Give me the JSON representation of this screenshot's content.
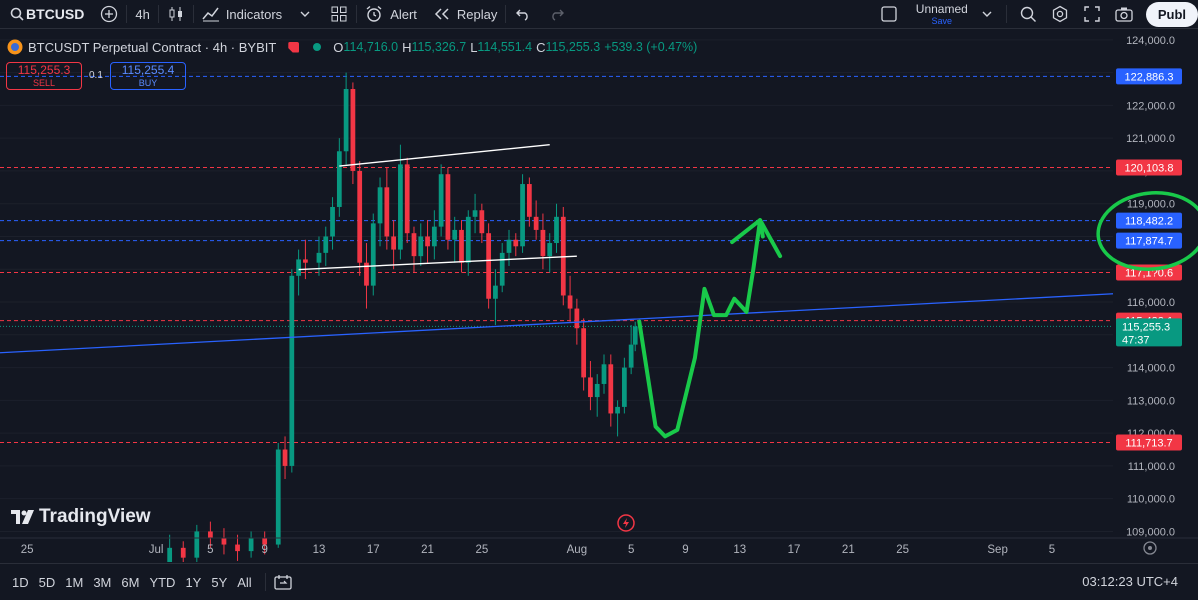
{
  "toolbar": {
    "symbol": "BTCUSD",
    "interval": "4h",
    "indicators": "Indicators",
    "alert": "Alert",
    "replay": "Replay",
    "layout_name": "Unnamed",
    "layout_status": "Save",
    "publish": "Publ"
  },
  "legend": {
    "title": "BTCUSDT Perpetual Contract · 4h · BYBIT",
    "o_label": "O",
    "o": "114,716.0",
    "h_label": "H",
    "h": "115,326.7",
    "l_label": "L",
    "l": "114,551.4",
    "c_label": "C",
    "c": "115,255.3",
    "change": "+539.3 (+0.47%)"
  },
  "trade": {
    "sell_price": "115,255.3",
    "sell_label": "SELL",
    "buy_price": "115,255.4",
    "buy_label": "BUY",
    "quantity": "0.1"
  },
  "price_axis": [
    "124,000.0",
    "123,000.0",
    "122,000.0",
    "121,000.0",
    "120,000.0",
    "119,000.0",
    "118,000.0",
    "117,000.0",
    "116,000.0",
    "115,000.0",
    "114,000.0",
    "113,000.0",
    "112,000.0",
    "111,000.0",
    "110,000.0",
    "109,000.0"
  ],
  "time_axis": [
    {
      "label": "25",
      "v": -9.5
    },
    {
      "label": "Jul",
      "v": 0
    },
    {
      "label": "5",
      "v": 4
    },
    {
      "label": "9",
      "v": 8
    },
    {
      "label": "13",
      "v": 12
    },
    {
      "label": "17",
      "v": 16
    },
    {
      "label": "21",
      "v": 20
    },
    {
      "label": "25",
      "v": 24
    },
    {
      "label": "Aug",
      "v": 31
    },
    {
      "label": "5",
      "v": 35
    },
    {
      "label": "9",
      "v": 39
    },
    {
      "label": "13",
      "v": 43
    },
    {
      "label": "17",
      "v": 47
    },
    {
      "label": "21",
      "v": 51
    },
    {
      "label": "25",
      "v": 55
    },
    {
      "label": "Sep",
      "v": 62
    },
    {
      "label": "5",
      "v": 66
    }
  ],
  "levels": [
    {
      "price": "122,886.3",
      "value": 122886.3,
      "color": "#2962ff"
    },
    {
      "price": "120,103.8",
      "value": 120103.8,
      "color": "#f23645"
    },
    {
      "price": "118,482.2",
      "value": 118482.2,
      "color": "#2962ff"
    },
    {
      "price": "117,874.7",
      "value": 117874.7,
      "color": "#2962ff"
    },
    {
      "price": "117,1?0.6",
      "value": 116900.0,
      "color": "#f23645"
    },
    {
      "price": "115,432.1",
      "value": 115432.1,
      "color": "#f23645"
    },
    {
      "price": "111,713.7",
      "value": 111713.7,
      "color": "#f23645"
    }
  ],
  "current": {
    "price": "115,255.3",
    "countdown": "47:37",
    "value": 115255.3,
    "color": "#089981"
  },
  "chart_data": {
    "type": "candlestick",
    "x_unit": "days from Jul 1",
    "series": [
      {
        "name": "BTCUSDT",
        "ohlc": [
          [
            1,
            107300,
            108900,
            107000,
            108500
          ],
          [
            2,
            108500,
            108700,
            107800,
            108200
          ],
          [
            3,
            108200,
            109200,
            107900,
            109000
          ],
          [
            4,
            109000,
            109300,
            108500,
            108800
          ],
          [
            5,
            108800,
            109100,
            108300,
            108600
          ],
          [
            6,
            108600,
            108900,
            108100,
            108400
          ],
          [
            7,
            108400,
            109000,
            108200,
            108800
          ],
          [
            8,
            108800,
            109000,
            108300,
            108600
          ],
          [
            9,
            108600,
            111700,
            108500,
            111500
          ],
          [
            9.5,
            111500,
            111900,
            110600,
            111000
          ],
          [
            10,
            111000,
            117000,
            110800,
            116800
          ],
          [
            10.5,
            116800,
            117600,
            116200,
            117300
          ],
          [
            11,
            117300,
            117900,
            116700,
            117200
          ],
          [
            12,
            117200,
            118000,
            116800,
            117500
          ],
          [
            12.5,
            117500,
            118300,
            117100,
            118000
          ],
          [
            13,
            118000,
            119200,
            117600,
            118900
          ],
          [
            13.5,
            118900,
            121000,
            118600,
            120600
          ],
          [
            14,
            120600,
            123000,
            120200,
            122500
          ],
          [
            14.5,
            122500,
            122700,
            119600,
            120000
          ],
          [
            15,
            120000,
            120300,
            116800,
            117200
          ],
          [
            15.5,
            117200,
            117800,
            115800,
            116500
          ],
          [
            16,
            116500,
            118700,
            116200,
            118400
          ],
          [
            16.5,
            118400,
            119800,
            117700,
            119500
          ],
          [
            17,
            119500,
            120100,
            117600,
            118000
          ],
          [
            17.5,
            118000,
            118500,
            117000,
            117600
          ],
          [
            18,
            117600,
            120800,
            117300,
            120200
          ],
          [
            18.5,
            120200,
            120400,
            117800,
            118100
          ],
          [
            19,
            118100,
            118300,
            116900,
            117400
          ],
          [
            19.5,
            117400,
            118400,
            117100,
            118000
          ],
          [
            20,
            118000,
            118500,
            117200,
            117700
          ],
          [
            20.5,
            117700,
            118800,
            117300,
            118300
          ],
          [
            21,
            118300,
            120200,
            118000,
            119900
          ],
          [
            21.5,
            119900,
            120100,
            117600,
            117900
          ],
          [
            22,
            117900,
            118600,
            117200,
            118200
          ],
          [
            22.5,
            118200,
            118500,
            116900,
            117200
          ],
          [
            23,
            117200,
            118800,
            116800,
            118600
          ],
          [
            23.5,
            118600,
            119300,
            118100,
            118800
          ],
          [
            24,
            118800,
            119000,
            117800,
            118100
          ],
          [
            24.5,
            118100,
            118400,
            115800,
            116100
          ],
          [
            25,
            116100,
            117000,
            115300,
            116500
          ],
          [
            25.5,
            116500,
            117800,
            116300,
            117500
          ],
          [
            26,
            117500,
            118200,
            117100,
            117900
          ],
          [
            26.5,
            117900,
            118100,
            117400,
            117700
          ],
          [
            27,
            117700,
            119900,
            117500,
            119600
          ],
          [
            27.5,
            119600,
            119800,
            118300,
            118600
          ],
          [
            28,
            118600,
            119100,
            117900,
            118200
          ],
          [
            28.5,
            118200,
            118700,
            117000,
            117400
          ],
          [
            29,
            117400,
            118100,
            116900,
            117800
          ],
          [
            29.5,
            117800,
            119000,
            117500,
            118600
          ],
          [
            30,
            118600,
            118900,
            115900,
            116200
          ],
          [
            30.5,
            116200,
            116800,
            115400,
            115800
          ],
          [
            31,
            115800,
            116100,
            114700,
            115200
          ],
          [
            31.5,
            115200,
            115500,
            113300,
            113700
          ],
          [
            32,
            113700,
            114200,
            112700,
            113100
          ],
          [
            32.5,
            113100,
            113800,
            112500,
            113500
          ],
          [
            33,
            113500,
            114400,
            113200,
            114100
          ],
          [
            33.5,
            114100,
            114400,
            112200,
            112600
          ],
          [
            34,
            112600,
            113000,
            111900,
            112800
          ],
          [
            34.5,
            112800,
            114300,
            112600,
            114000
          ],
          [
            35,
            114000,
            115300,
            113800,
            114700
          ],
          [
            35.3,
            114700,
            115400,
            114500,
            115255
          ]
        ]
      }
    ],
    "trendlines": [
      {
        "name": "channel top",
        "points": [
          [
            13.5,
            120150
          ],
          [
            29,
            120800
          ]
        ],
        "color": "#ffffff"
      },
      {
        "name": "channel bottom",
        "points": [
          [
            10.5,
            116990
          ],
          [
            31,
            117400
          ]
        ],
        "color": "#ffffff"
      },
      {
        "name": "rising support",
        "points": [
          [
            -23,
            114200
          ],
          [
            80,
            116460
          ]
        ],
        "color": "#2962ff"
      }
    ],
    "drawing": {
      "name": "projected path",
      "color": "#19c94a",
      "points": [
        [
          35.6,
          115400
        ],
        [
          36.8,
          112200
        ],
        [
          37.5,
          111900
        ],
        [
          38.4,
          112100
        ],
        [
          39.7,
          114300
        ],
        [
          40.4,
          116400
        ],
        [
          41.1,
          115600
        ],
        [
          42.0,
          115600
        ],
        [
          42.6,
          116100
        ],
        [
          43.5,
          115700
        ],
        [
          44.0,
          117000
        ],
        [
          44.5,
          118500
        ],
        [
          44.7,
          118000
        ]
      ]
    },
    "ylim": [
      108800,
      124300
    ],
    "xlim": [
      -11.5,
      70.5
    ]
  },
  "bottom": {
    "ranges": [
      "1D",
      "5D",
      "1M",
      "3M",
      "6M",
      "YTD",
      "1Y",
      "5Y",
      "All"
    ],
    "clock": "03:12:23 UTC+4"
  },
  "watermark": "TradingView"
}
